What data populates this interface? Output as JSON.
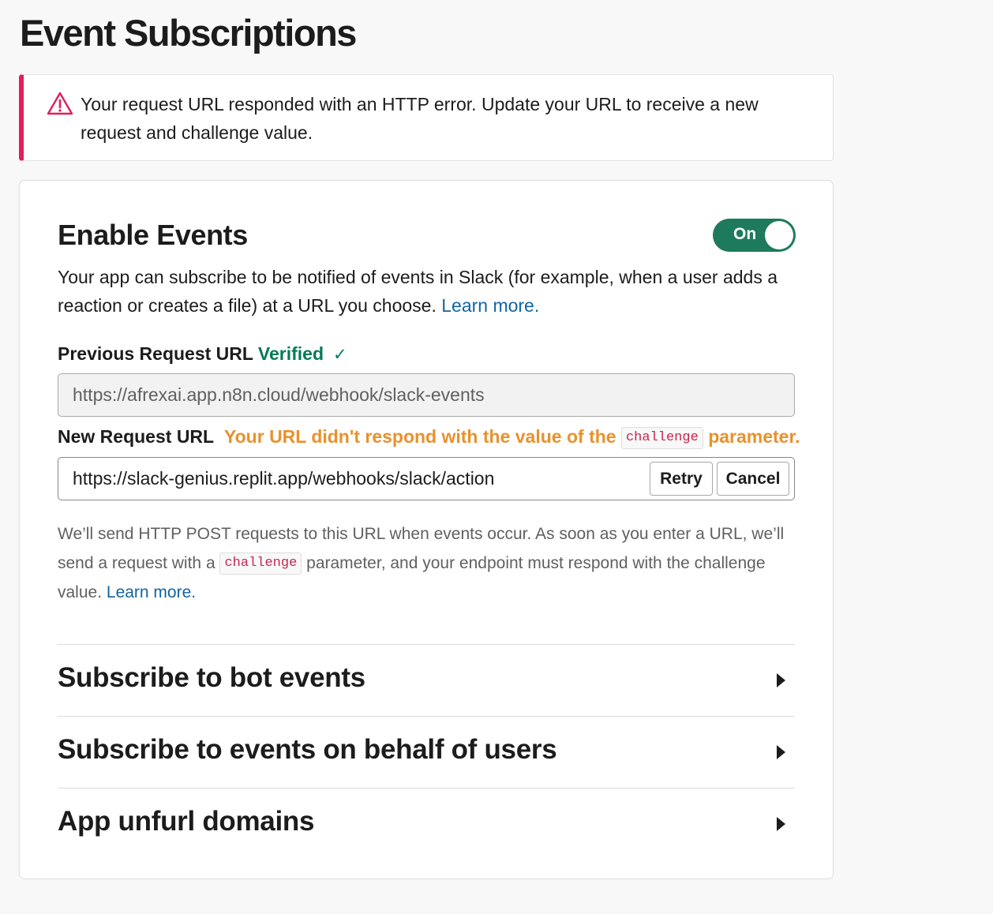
{
  "page": {
    "title": "Event Subscriptions"
  },
  "alert": {
    "icon": "warning-triangle-icon",
    "message": "Your request URL responded with an HTTP error. Update your URL to receive a new request and challenge value.",
    "color": "#e01e5a"
  },
  "enable_events": {
    "title": "Enable Events",
    "toggle_label": "On",
    "toggle_on": true,
    "toggle_color": "#1e7a5c",
    "description": "Your app can subscribe to be notified of events in Slack (for example, when a user adds a reaction or creates a file) at a URL you choose.",
    "learn_more": "Learn more."
  },
  "previous_url": {
    "label": "Previous Request URL",
    "status": "Verified",
    "status_icon": "checkmark-icon",
    "value": "https://afrexai.app.n8n.cloud/webhook/slack-events"
  },
  "new_url": {
    "label": "New Request URL",
    "warning_prefix": "Your URL didn't respond with the value of the",
    "warning_code": "challenge",
    "warning_suffix": "parameter.",
    "value": "https://slack-genius.replit.app/webhooks/slack/action",
    "retry_label": "Retry",
    "cancel_label": "Cancel"
  },
  "help": {
    "text_1": "We’ll send HTTP POST requests to this URL when events occur. As soon as you enter a URL, we’ll send a request with a",
    "code": "challenge",
    "text_2": "parameter, and your endpoint must respond with the challenge value.",
    "learn_more": "Learn more."
  },
  "sections": [
    {
      "title": "Subscribe to bot events",
      "icon": "caret-right-icon"
    },
    {
      "title": "Subscribe to events on behalf of users",
      "icon": "caret-right-icon"
    },
    {
      "title": "App unfurl domains",
      "icon": "caret-right-icon"
    }
  ]
}
